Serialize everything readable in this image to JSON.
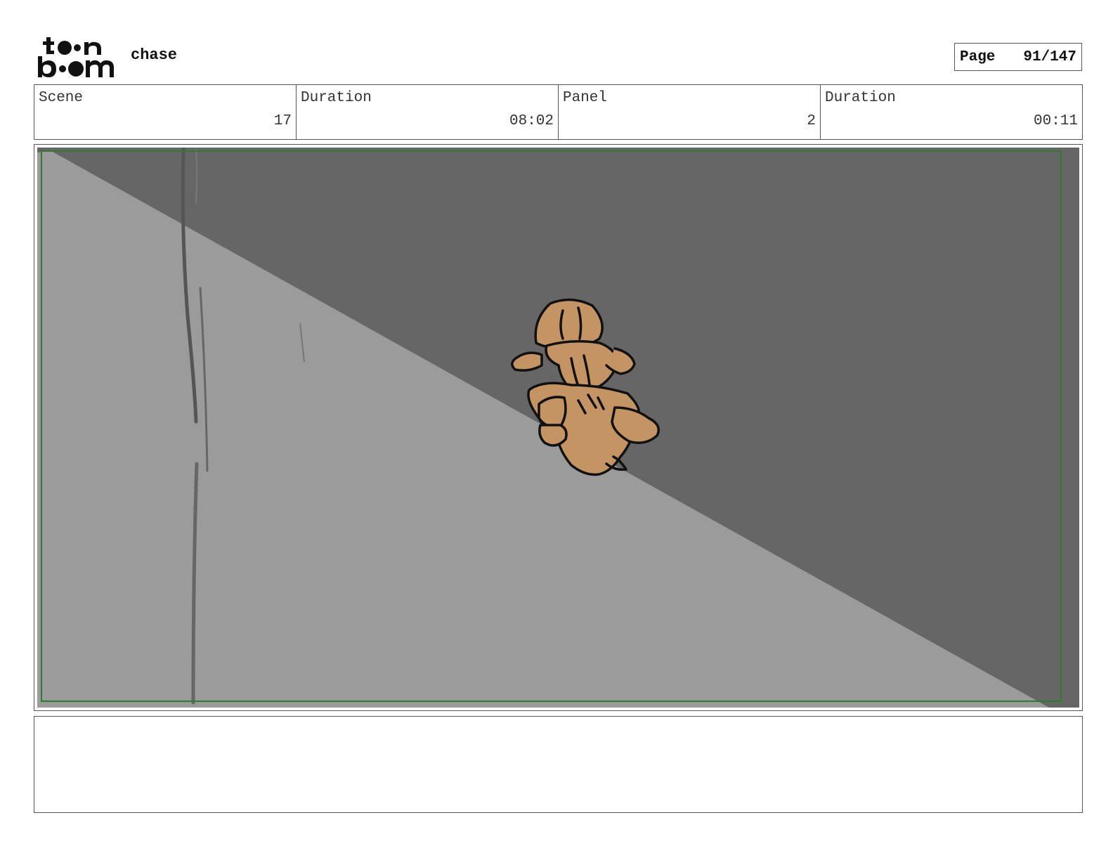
{
  "header": {
    "logo_alt": "toon boom",
    "project_title": "chase",
    "page_label": "Page",
    "page_value": "91/147"
  },
  "info": {
    "scene_label": "Scene",
    "scene_value": "17",
    "scene_duration_label": "Duration",
    "scene_duration_value": "08:02",
    "panel_label": "Panel",
    "panel_value": "2",
    "panel_duration_label": "Duration",
    "panel_duration_value": "00:11"
  },
  "colors": {
    "wall_light": "#9b9b9b",
    "wall_dark": "#666666",
    "safe_frame": "#2e7d2e",
    "character_fill": "#c49563",
    "ink": "#111111"
  },
  "icons": {
    "logo": "toon-boom-logo"
  },
  "notes": {
    "text": ""
  }
}
